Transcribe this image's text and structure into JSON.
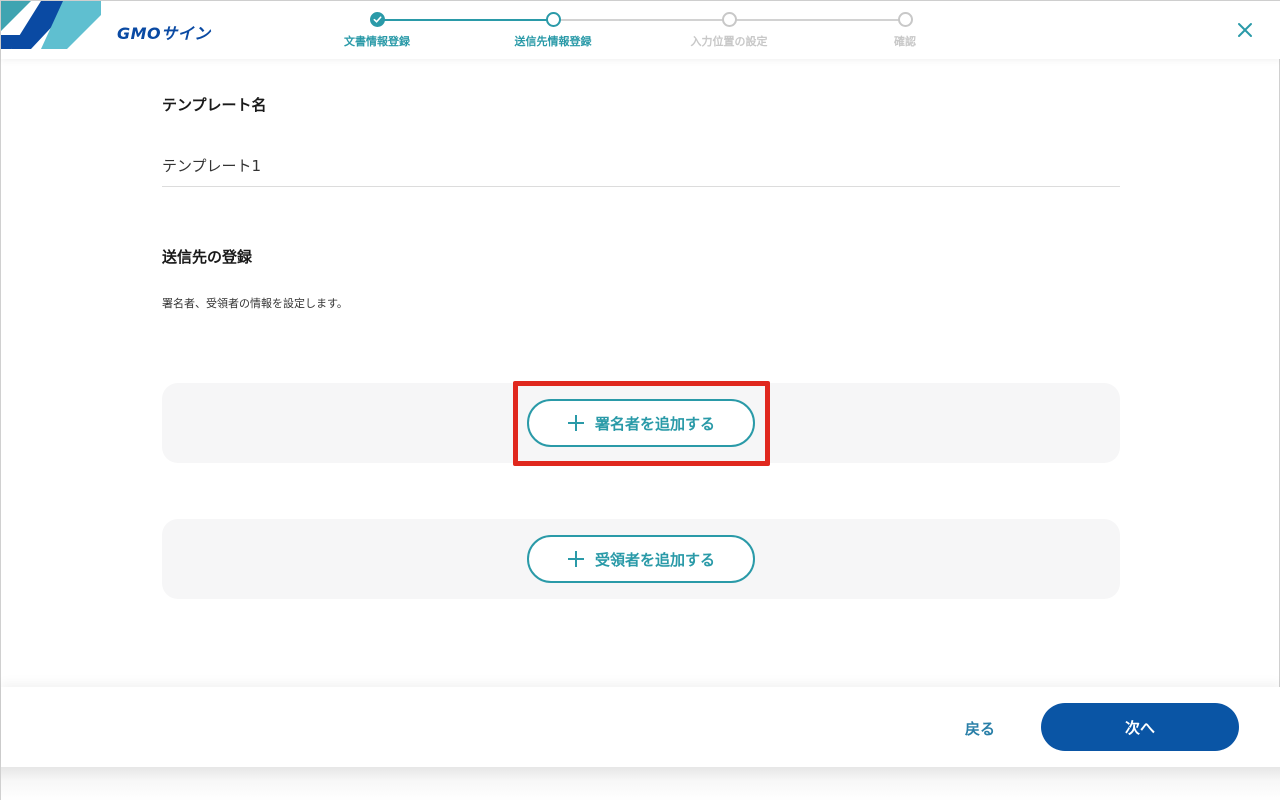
{
  "brand": {
    "logo_text": "GMOサイン",
    "logo_color": "#0a4aa3"
  },
  "stepper": {
    "steps": [
      {
        "label": "文書情報登録",
        "state": "done"
      },
      {
        "label": "送信先情報登録",
        "state": "current"
      },
      {
        "label": "入力位置の設定",
        "state": "pending"
      },
      {
        "label": "確認",
        "state": "pending"
      }
    ],
    "accent": "#2a9aa8"
  },
  "header": {
    "close_icon": "close-icon"
  },
  "template": {
    "title": "テンプレート名",
    "value": "テンプレート1"
  },
  "destination": {
    "title": "送信先の登録",
    "description": "署名者、受領者の情報を設定します。",
    "add_signer_label": "署名者を追加する",
    "add_recipient_label": "受領者を追加する"
  },
  "footer": {
    "back_label": "戻る",
    "next_label": "次へ",
    "next_color": "#0a55a5"
  },
  "highlight_color": "#e0281e"
}
